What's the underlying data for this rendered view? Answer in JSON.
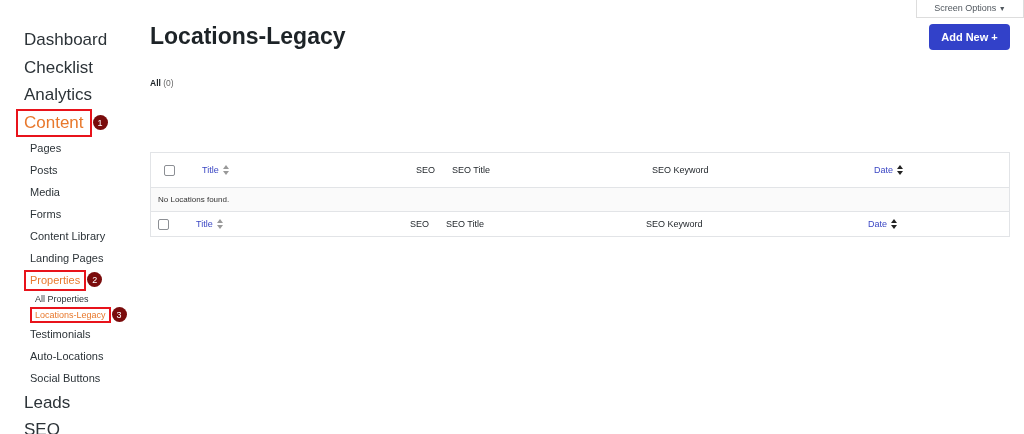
{
  "sidebar": {
    "items": [
      {
        "label": "Dashboard",
        "selected": false
      },
      {
        "label": "Checklist",
        "selected": false
      },
      {
        "label": "Analytics",
        "selected": false
      },
      {
        "label": "Content",
        "selected": true,
        "annotation": "1",
        "children": [
          {
            "label": "Pages",
            "selected": false
          },
          {
            "label": "Posts",
            "selected": false
          },
          {
            "label": "Media",
            "selected": false
          },
          {
            "label": "Forms",
            "selected": false
          },
          {
            "label": "Content Library",
            "selected": false
          },
          {
            "label": "Landing Pages",
            "selected": false
          },
          {
            "label": "Properties",
            "selected": true,
            "annotation": "2",
            "children": [
              {
                "label": "All Properties",
                "selected": false
              },
              {
                "label": "Locations-Legacy",
                "selected": true,
                "annotation": "3"
              }
            ]
          },
          {
            "label": "Testimonials",
            "selected": false
          },
          {
            "label": "Auto-Locations",
            "selected": false
          },
          {
            "label": "Social Buttons",
            "selected": false
          }
        ]
      },
      {
        "label": "Leads",
        "selected": false
      },
      {
        "label": "SEO",
        "selected": false
      }
    ]
  },
  "screen_options": {
    "label": "Screen Options",
    "caret": "▼"
  },
  "page_title": "Locations-Legacy",
  "add_button": "Add New +",
  "filters": [
    {
      "label": "All",
      "count": "(0)"
    }
  ],
  "table": {
    "header_checkbox": {
      "checked": false
    },
    "header": [
      {
        "label": "Title",
        "kind": "sortable",
        "sorted": false
      },
      {
        "label": "SEO",
        "kind": "plain"
      },
      {
        "label": "SEO Title",
        "kind": "plain"
      },
      {
        "label": "SEO Keyword",
        "kind": "plain"
      },
      {
        "label": "Date",
        "kind": "sortable",
        "sorted": true
      }
    ],
    "empty_message": "No Locations found.",
    "footer_checkbox": {
      "checked": false
    },
    "footer": [
      {
        "label": "Title",
        "kind": "sortable",
        "sorted": false
      },
      {
        "label": "SEO",
        "kind": "plain"
      },
      {
        "label": "SEO Title",
        "kind": "plain"
      },
      {
        "label": "SEO Keyword",
        "kind": "plain"
      },
      {
        "label": "Date",
        "kind": "sortable",
        "sorted": true
      }
    ]
  }
}
